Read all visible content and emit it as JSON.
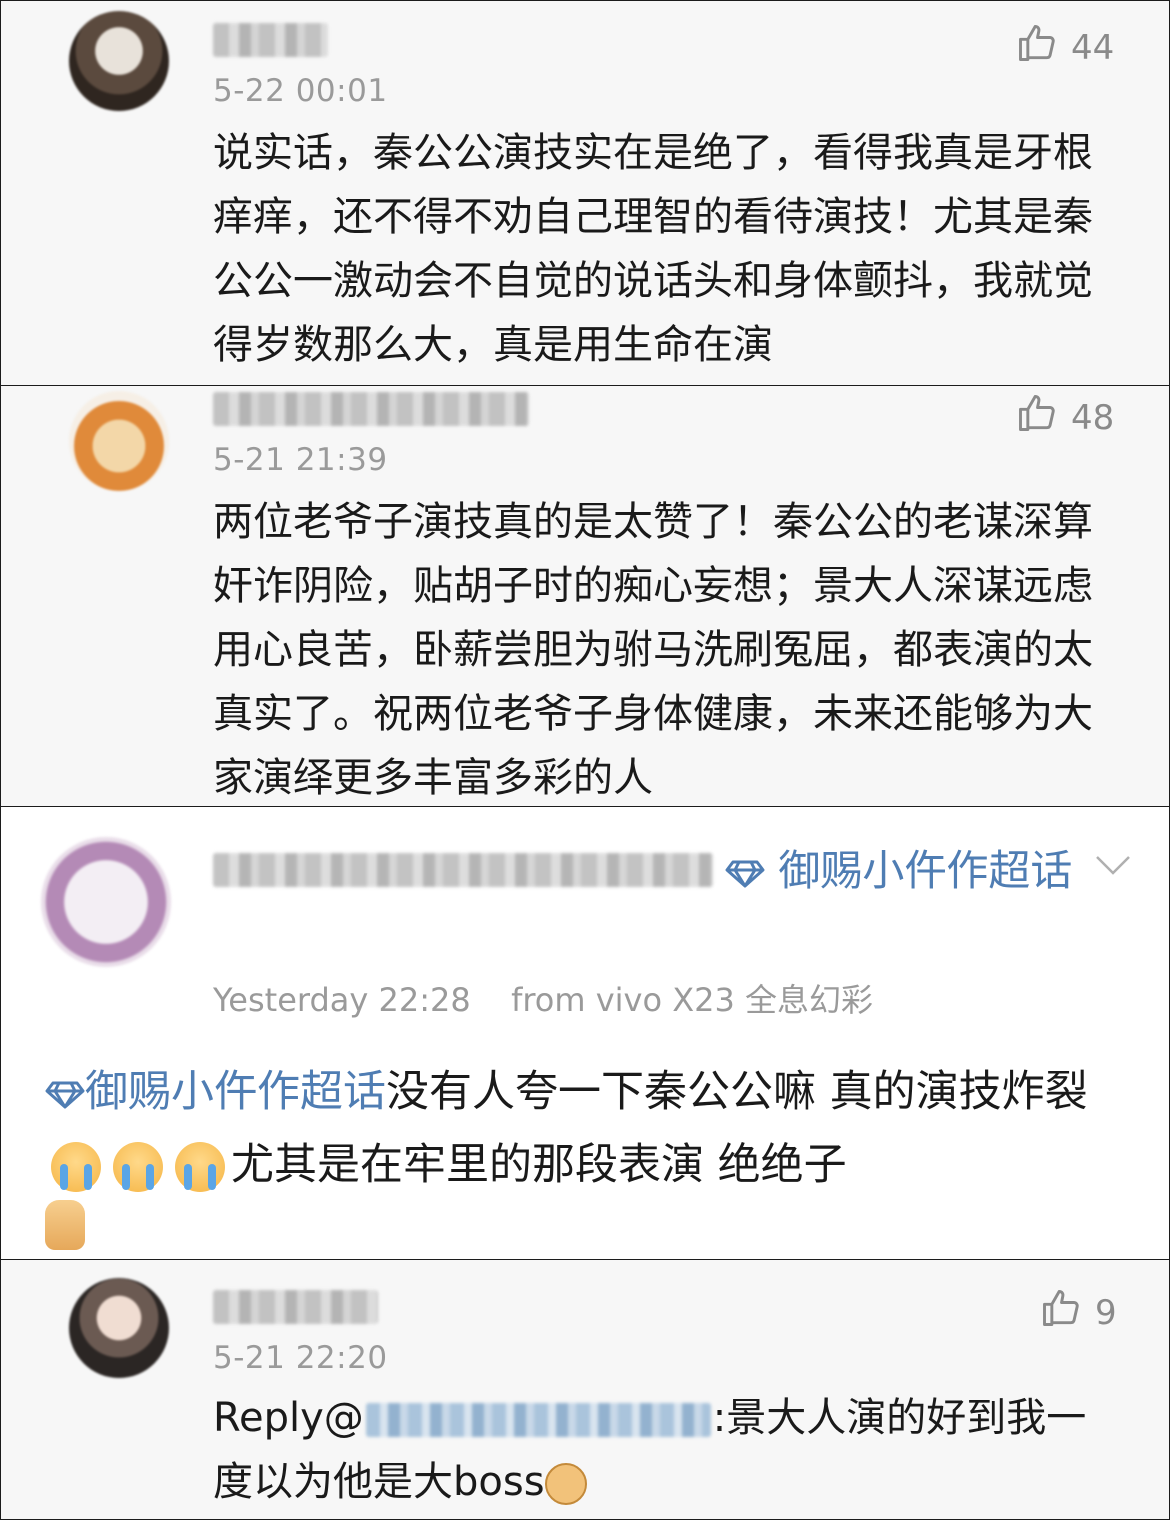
{
  "comments": [
    {
      "timestamp": "5-22 00:01",
      "likes": "44",
      "text": "说实话，秦公公演技实在是绝了，看得我真是牙根痒痒，还不得不劝自己理智的看待演技！尤其是秦公公一激动会不自觉的说话头和身体颤抖，我就觉得岁数那么大，真是用生命在演"
    },
    {
      "timestamp": "5-21 21:39",
      "likes": "48",
      "text": "两位老爷子演技真的是太赞了！秦公公的老谋深算奸诈阴险，贴胡子时的痴心妄想；景大人深谋远虑用心良苦，卧薪尝胆为驸马洗刷冤屈，都表演的太真实了。祝两位老爷子身体健康，未来还能够为大家演绎更多丰富多彩的人"
    },
    {
      "topic_tag": "御赐小仵作超话",
      "timestamp": "Yesterday 22:28",
      "source": "from vivo X23 全息幻彩",
      "text_tag": "御赐小仵作超话",
      "text_part1": "没有人夸一下秦公公嘛 真的演技炸裂",
      "text_part2": "尤其是在牢里的那段表演 绝绝子"
    },
    {
      "timestamp": "5-21 22:20",
      "likes": "9",
      "reply_prefix": "Reply@",
      "reply_text": ":景大人演的好到我一度以为他是大boss"
    }
  ],
  "icons": {
    "like": "thumbs-up-outline-icon",
    "topic": "diamond-icon",
    "dropdown": "chevron-down-icon",
    "crying": "crying-face-emoji",
    "thumb": "thumbs-up-emoji",
    "doge": "doge-emoji"
  },
  "colors": {
    "topic_blue": "#4f7db3",
    "meta_gray": "#9a9a9a",
    "panel_gray": "#f7f7f7"
  }
}
